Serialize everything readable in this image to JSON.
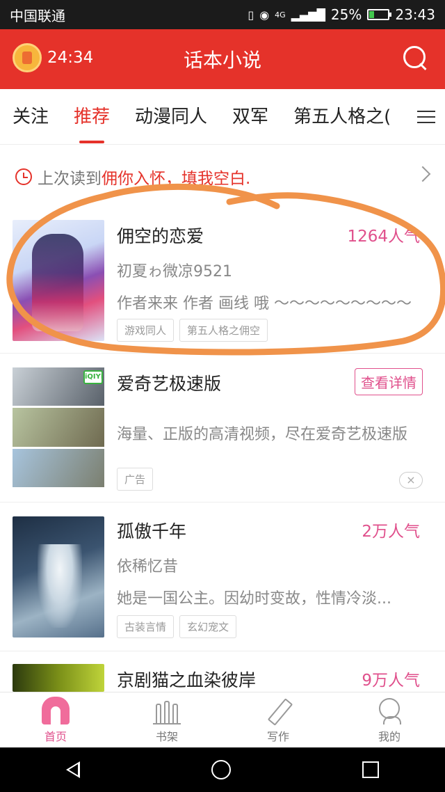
{
  "status_bar": {
    "carrier": "中国联通",
    "network": "4G",
    "battery": "25%",
    "battery_level": 0.25,
    "time": "23:43"
  },
  "header": {
    "timer": "24:34",
    "title": "话本小说"
  },
  "tabs": [
    "关注",
    "推荐",
    "动漫同人",
    "双军",
    "第五人格之("
  ],
  "active_tab": "推荐",
  "last_read": {
    "prefix": "上次读到",
    "book": "佣你入怀，填我空白."
  },
  "books": [
    {
      "title": "佣空的恋爱",
      "popularity": "1264人气",
      "author": "初夏ゎ微凉9521",
      "description": "作者来来 作者 画线 哦 ～～～～～～～～～",
      "tags": [
        "游戏同人",
        "第五人格之佣空"
      ]
    },
    {
      "title": "孤傲千年",
      "popularity": "2万人气",
      "author": "依稀忆昔",
      "description": "她是一国公主。因幼时变故，性情冷淡...",
      "tags": [
        "古装言情",
        "玄幻宠文"
      ]
    },
    {
      "title": "京剧猫之血染彼岸",
      "popularity": "9万人气"
    }
  ],
  "ad": {
    "title": "爱奇艺极速版",
    "description": "海量、正版的高清视频，尽在爱奇艺极速版",
    "detail_button": "查看详情",
    "label": "广告",
    "badge": "iQIYI",
    "close_icon": "×"
  },
  "bottom_nav": [
    {
      "label": "首页",
      "icon": "home-icon"
    },
    {
      "label": "书架",
      "icon": "bookshelf-icon"
    },
    {
      "label": "写作",
      "icon": "pen-icon"
    },
    {
      "label": "我的",
      "icon": "profile-icon"
    }
  ],
  "colors": {
    "brand_red": "#e5322a",
    "popularity_pink": "#e0508c",
    "annotation_orange": "#f0934a"
  }
}
